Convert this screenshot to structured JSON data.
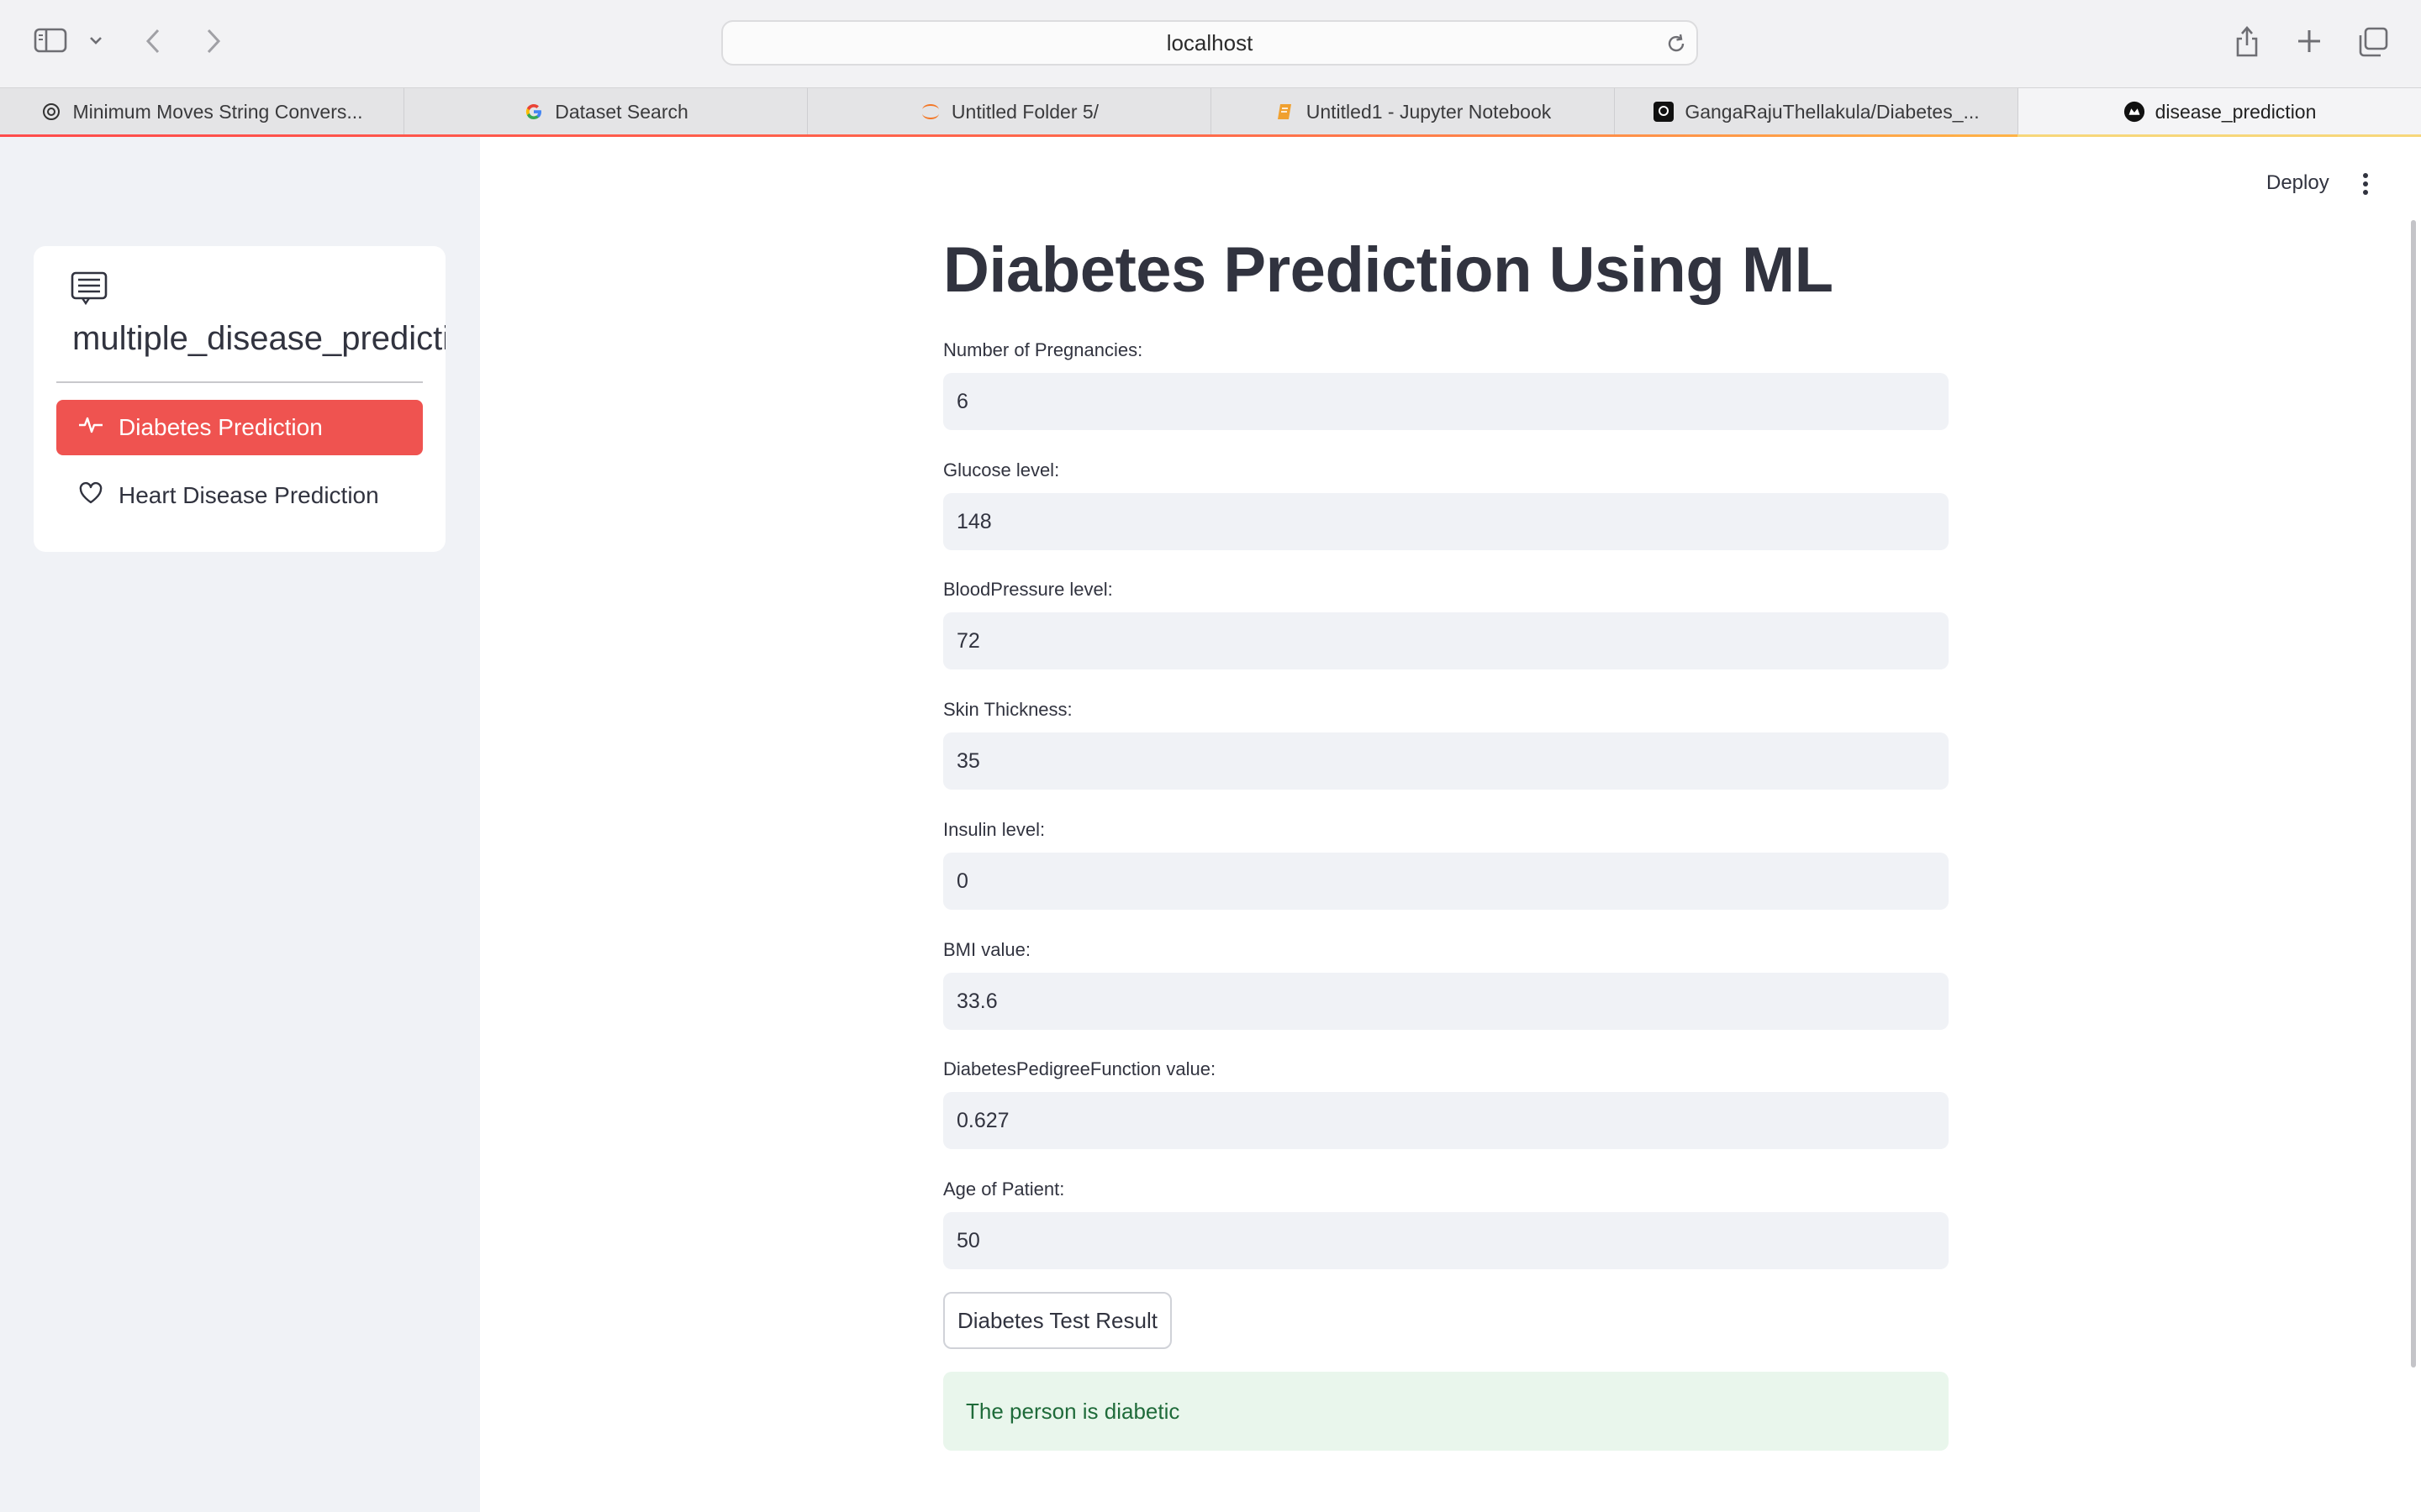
{
  "browser": {
    "url": "localhost",
    "tabs": [
      {
        "title": "Minimum Moves String Convers...",
        "icon": "openai-icon"
      },
      {
        "title": "Dataset Search",
        "icon": "google-icon"
      },
      {
        "title": "Untitled Folder 5/",
        "icon": "jupyter-icon"
      },
      {
        "title": "Untitled1 - Jupyter Notebook",
        "icon": "notebook-icon"
      },
      {
        "title": "GangaRajuThellakula/Diabetes_...",
        "icon": "github-icon"
      },
      {
        "title": "disease_prediction",
        "icon": "streamlit-icon",
        "active": true
      }
    ]
  },
  "sidebar": {
    "menu_title": "multiple_disease_prediction",
    "items": [
      {
        "label": "Diabetes Prediction",
        "icon": "activity-icon",
        "active": true
      },
      {
        "label": "Heart Disease Prediction",
        "icon": "heart-icon",
        "active": false
      }
    ]
  },
  "header": {
    "deploy_label": "Deploy"
  },
  "main": {
    "title": "Diabetes Prediction Using ML",
    "fields": [
      {
        "label": "Number of Pregnancies:",
        "value": "6"
      },
      {
        "label": "Glucose level:",
        "value": "148"
      },
      {
        "label": "BloodPressure level:",
        "value": "72"
      },
      {
        "label": "Skin Thickness:",
        "value": "35"
      },
      {
        "label": "Insulin level:",
        "value": "0"
      },
      {
        "label": "BMI value:",
        "value": "33.6"
      },
      {
        "label": "DiabetesPedigreeFunction value:",
        "value": "0.627"
      },
      {
        "label": "Age of Patient:",
        "value": "50"
      }
    ],
    "button_label": "Diabetes Test Result",
    "result_text": "The person is diabetic"
  },
  "colors": {
    "accent": "#ef5350",
    "sidebar_bg": "#f0f2f6",
    "success_bg": "#e9f6ec",
    "success_text": "#1f6b3a"
  }
}
